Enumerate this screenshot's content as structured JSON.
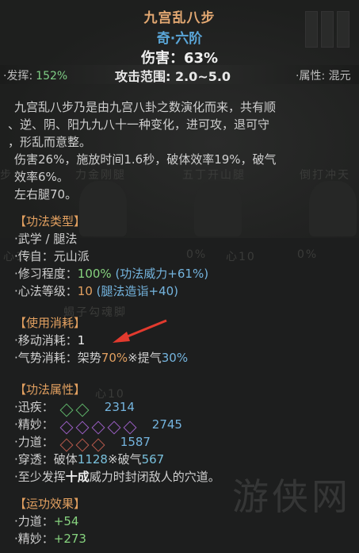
{
  "header": {
    "title": "九宫乱八步",
    "rank": "奇·六阶",
    "damage": "伤害：63%"
  },
  "statbar": {
    "perform_label": "·发挥:",
    "perform_value": "152%",
    "range": "攻击范围: 2.0~5.0",
    "attr": "·属性: 混元"
  },
  "description": [
    "九宫乱八步乃是由九宫八卦之数演化而来，共有顺",
    "、逆、阴、阳九九八十一种变化，进可攻，退可守",
    "，形乱而意整。",
    "伤害26%，施放时间1.6秒，破体效率19%，破气",
    "效率6%。",
    "左右腿70。"
  ],
  "type_section": {
    "header": "【功法类型】",
    "category": "·武学 / 腿法",
    "origin": "·传自：元山派",
    "practice_label": "·修习程度：",
    "practice_value": "100%",
    "practice_extra": "(功法威力+61%)",
    "heart_label": "·心法等级：",
    "heart_value": "10",
    "heart_extra": "(腿法造诣+40)"
  },
  "cost_section": {
    "header": "【使用消耗】",
    "move_label": "·移动消耗：",
    "move_value": "1",
    "qi_label": "·气势消耗：",
    "qi_stance": "架势",
    "qi_stance_value": "70%",
    "qi_sep": "※",
    "qi_breath": "提气",
    "qi_breath_value": "30%"
  },
  "attr_section": {
    "header": "【功法属性】",
    "speed_label": "·迅疾：",
    "speed_value": "2314",
    "finesse_label": "·精妙：",
    "finesse_value": "2745",
    "power_label": "·力道：",
    "power_value": "1587",
    "pierce_label": "·穿透：",
    "pierce_body": "破体",
    "pierce_body_value": "1128",
    "pierce_sep": "※",
    "pierce_qi": "破气",
    "pierce_qi_value": "567",
    "note_pre": "·至少发挥",
    "note_bold": "十成",
    "note_post": "威力时封闭敌人的穴道。"
  },
  "effect_section": {
    "header": "【运功效果】",
    "power_label": "·力道：",
    "power_value": "+54",
    "finesse_label": "·精妙：",
    "finesse_value": "+273"
  },
  "background": {
    "ghost_labels": [
      "步",
      "力金刚腿",
      "五丁开山腿",
      "倒打冲天",
      "心10",
      "0%",
      "心10",
      "0%",
      "蝎子勾魂脚",
      "心10"
    ]
  },
  "watermark": "游侠网",
  "colors": {
    "title": "#e3a872",
    "rank": "#5aa6d8",
    "section": "#e2a060",
    "positive": "#86d27e",
    "value_blue": "#74b4de",
    "arrow": "#e23a2e"
  }
}
